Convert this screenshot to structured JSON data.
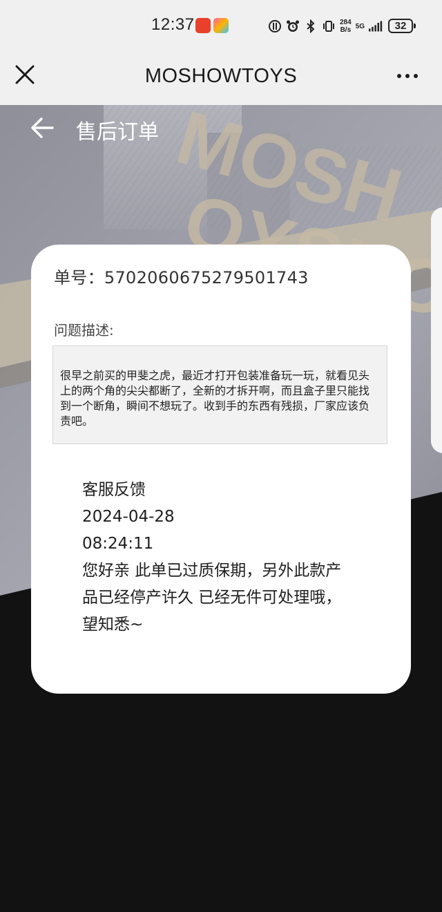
{
  "status_bar": {
    "time": "12:37",
    "net_speed_value": "284",
    "net_speed_unit": "B/s",
    "network": "5G",
    "battery": "32"
  },
  "title_bar": {
    "title": "MOSHOWTOYS",
    "close_icon": "close-icon",
    "more_icon": "more-icon"
  },
  "page": {
    "title": "售后订单",
    "back_icon": "arrow-left-icon"
  },
  "order": {
    "number_label": "单号：",
    "number": "5702060675279501743",
    "description_label": "问题描述:",
    "description": "很早之前买的甲斐之虎，最近才打开包装准备玩一玩，就看见头上的两个角的尖尖都断了，全新的才拆开啊，而且盒子里只能找到一个断角，瞬间不想玩了。收到手的东西有残损，厂家应该负责吧。"
  },
  "feedback": {
    "title": "客服反馈",
    "date": "2024-04-28",
    "time": "08:24:11",
    "message": "您好亲 此单已过质保期，另外此款产品已经停产许久 已经无件可处理哦，望知悉~"
  },
  "colors": {
    "title_bar_bg": "#f0f0f0",
    "page_bg": "#121212",
    "card_bg": "#ffffff",
    "accent_beige": "#c9bda8"
  }
}
